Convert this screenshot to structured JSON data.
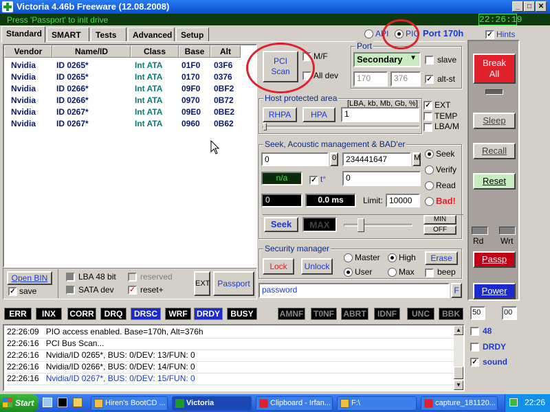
{
  "window": {
    "title": "Victoria 4.46b Freeware (12.08.2008)",
    "status_message": "Press 'Passport' to init drive",
    "clock": "22:26:19"
  },
  "tabs": [
    "Standard",
    "SMART",
    "Tests",
    "Advanced",
    "Setup"
  ],
  "port_mode": {
    "api_label": "API",
    "pio_label": "PIO",
    "port_label": "Port 170h",
    "hints_label": "Hints"
  },
  "grid": {
    "headers": [
      "Vendor",
      "Name/ID",
      "Class",
      "Base",
      "Alt"
    ],
    "rows": [
      {
        "vendor": "Nvidia",
        "name": "ID 0265*",
        "class": "Int ATA",
        "base": "01F0",
        "alt": "03F6"
      },
      {
        "vendor": "Nvidia",
        "name": "ID 0265*",
        "class": "Int ATA",
        "base": "0170",
        "alt": "0376"
      },
      {
        "vendor": "Nvidia",
        "name": "ID 0266*",
        "class": "Int ATA",
        "base": "09F0",
        "alt": "0BF2"
      },
      {
        "vendor": "Nvidia",
        "name": "ID 0266*",
        "class": "Int ATA",
        "base": "0970",
        "alt": "0B72"
      },
      {
        "vendor": "Nvidia",
        "name": "ID 0267*",
        "class": "Int ATA",
        "base": "09E0",
        "alt": "0BE2"
      },
      {
        "vendor": "Nvidia",
        "name": "ID 0267*",
        "class": "Int ATA",
        "base": "0960",
        "alt": "0B62"
      }
    ]
  },
  "pci": {
    "scan_line1": "PCI",
    "scan_line2": "Scan",
    "mf_label": "M/F",
    "alldev_label": "All dev"
  },
  "port": {
    "group_label": "Port",
    "selected": "Secondary",
    "slave_label": "slave",
    "base": "170",
    "alt": "376",
    "altst_label": "alt-st"
  },
  "hpa": {
    "group_label": "Host protected area",
    "units_label": "[LBA, kb, Mb, Gb, %]",
    "rhpa": "RHPA",
    "hpa": "HPA",
    "value": "1",
    "ext_label": "EXT",
    "temp_label": "TEMP",
    "lbam_label": "LBA/M"
  },
  "seek": {
    "group_label": "Seek, Acoustic management & BAD'er",
    "start": "0",
    "start_btn": "0",
    "end": "234441647",
    "end_btn": "M",
    "na": "n/a",
    "temp_label": "t°",
    "temp_value": "0",
    "lba_value": "0",
    "time": "0.0 ms",
    "limit_label": "Limit:",
    "limit_value": "10000",
    "seek_btn": "Seek",
    "max_btn": "MAX",
    "min_label": "MIN",
    "off_label": "OFF",
    "opt_seek": "Seek",
    "opt_verify": "Verify",
    "opt_read": "Read",
    "opt_bad": "Bad!"
  },
  "security": {
    "group_label": "Security manager",
    "lock": "Lock",
    "unlock": "Unlock",
    "master": "Master",
    "high": "High",
    "erase": "Erase",
    "user": "User",
    "max": "Max",
    "beep": "beep",
    "password_placeholder": "password",
    "f_btn": "F"
  },
  "bottom_left": {
    "open_bin": "Open BIN",
    "save": "save",
    "lba48": "LBA 48 bit",
    "reserved": "reserved",
    "sata": "SATA dev",
    "reset_plus": "reset+",
    "ext": "EXT",
    "passport": "Passport"
  },
  "right_panel": {
    "break_line1": "Break",
    "break_line2": "All",
    "sleep": "Sleep",
    "recall": "Recall",
    "reset": "Reset",
    "rd": "Rd",
    "wrt": "Wrt",
    "passp": "Passp",
    "power": "Power",
    "timeout": "50",
    "zero": "00"
  },
  "flags": [
    "ERR",
    "INX",
    "CORR",
    "DRQ",
    "DRSC",
    "WRF",
    "DRDY",
    "BUSY",
    "AMNF",
    "T0NF",
    "ABRT",
    "IDNF",
    "UNC",
    "BBK"
  ],
  "log": [
    {
      "time": "22:26:09",
      "text": "PIO access enabled. Base=170h, Alt=376h",
      "color": "#000000"
    },
    {
      "time": "22:26:16",
      "text": "PCI Bus Scan...",
      "color": "#000000"
    },
    {
      "time": "22:26:16",
      "text": "Nvidia/ID 0265*, BUS: 0/DEV: 13/FUN: 0",
      "color": "#000000"
    },
    {
      "time": "22:26:16",
      "text": "Nvidia/ID 0266*, BUS: 0/DEV: 14/FUN: 0",
      "color": "#000000"
    },
    {
      "time": "22:26:16",
      "text": "Nvidia/ID 0267*, BUS: 0/DEV: 15/FUN: 0",
      "color": "#1a3ad4"
    }
  ],
  "log_side": {
    "v48": "48",
    "drdy": "DRDY",
    "sound": "sound"
  },
  "taskbar": {
    "start": "Start",
    "items": [
      "Hiren's BootCD ...",
      "Victoria",
      "Clipboard - Irfan...",
      "F:\\",
      "capture_181120..."
    ],
    "clock": "22:26"
  }
}
